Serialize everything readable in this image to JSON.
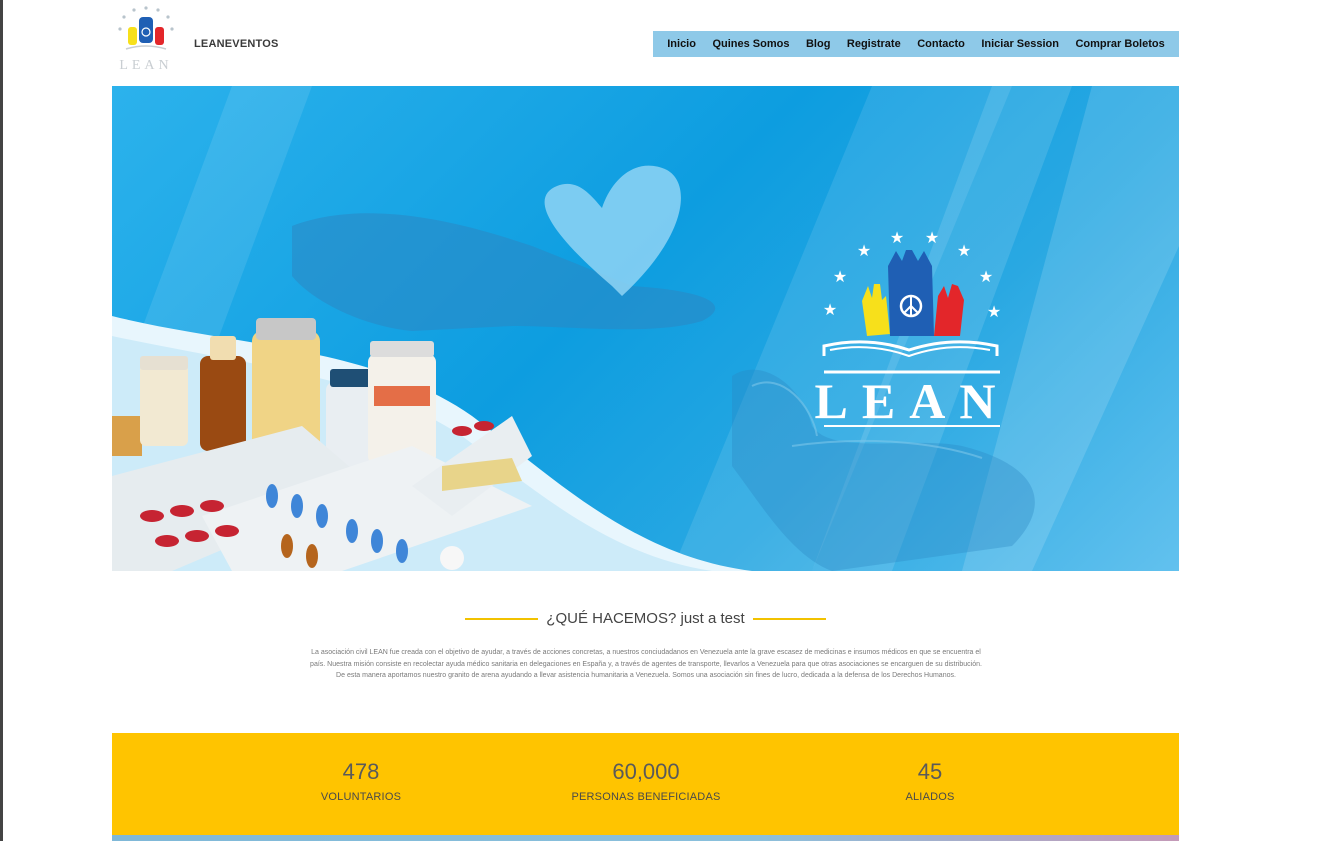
{
  "header": {
    "brand": "LEANEVENTOS",
    "logo_text": "LEAN",
    "nav": [
      "Inicio",
      "Quines Somos",
      "Blog",
      "Registrate",
      "Contacto",
      "Iniciar Session",
      "Comprar Boletos"
    ]
  },
  "hero": {
    "logo_text": "LEAN",
    "background_color": "#0d9de0",
    "logo_colors": [
      "#f7e01b",
      "#1f5fb4",
      "#e3262a"
    ]
  },
  "section": {
    "title": "¿QUÉ HACEMOS? just a test",
    "accent_color": "#f2c200",
    "text_lines": [
      "La asociación civil LEAN fue creada con el objetivo de ayudar, a través de acciones concretas, a nuestros conciudadanos en Venezuela ante la grave escasez de medicinas e insumos médicos en que se encuentra el",
      "país. Nuestra misión consiste en recolectar ayuda médico sanitaria en delegaciones en España y, a través de agentes de transporte, llevarlos a Venezuela para que otras asociaciones se encarguen de su distribución.",
      "De esta manera aportamos nuestro granito de arena ayudando a llevar asistencia humanitaria a Venezuela. Somos una asociación sin fines de lucro, dedicada a la defensa de los Derechos Humanos."
    ]
  },
  "stats": {
    "background_color": "#ffc400",
    "items": [
      {
        "number": "478",
        "label": "VOLUNTARIOS"
      },
      {
        "number": "60,000",
        "label": "PERSONAS BENEFICIADAS"
      },
      {
        "number": "45",
        "label": "ALIADOS"
      }
    ]
  }
}
